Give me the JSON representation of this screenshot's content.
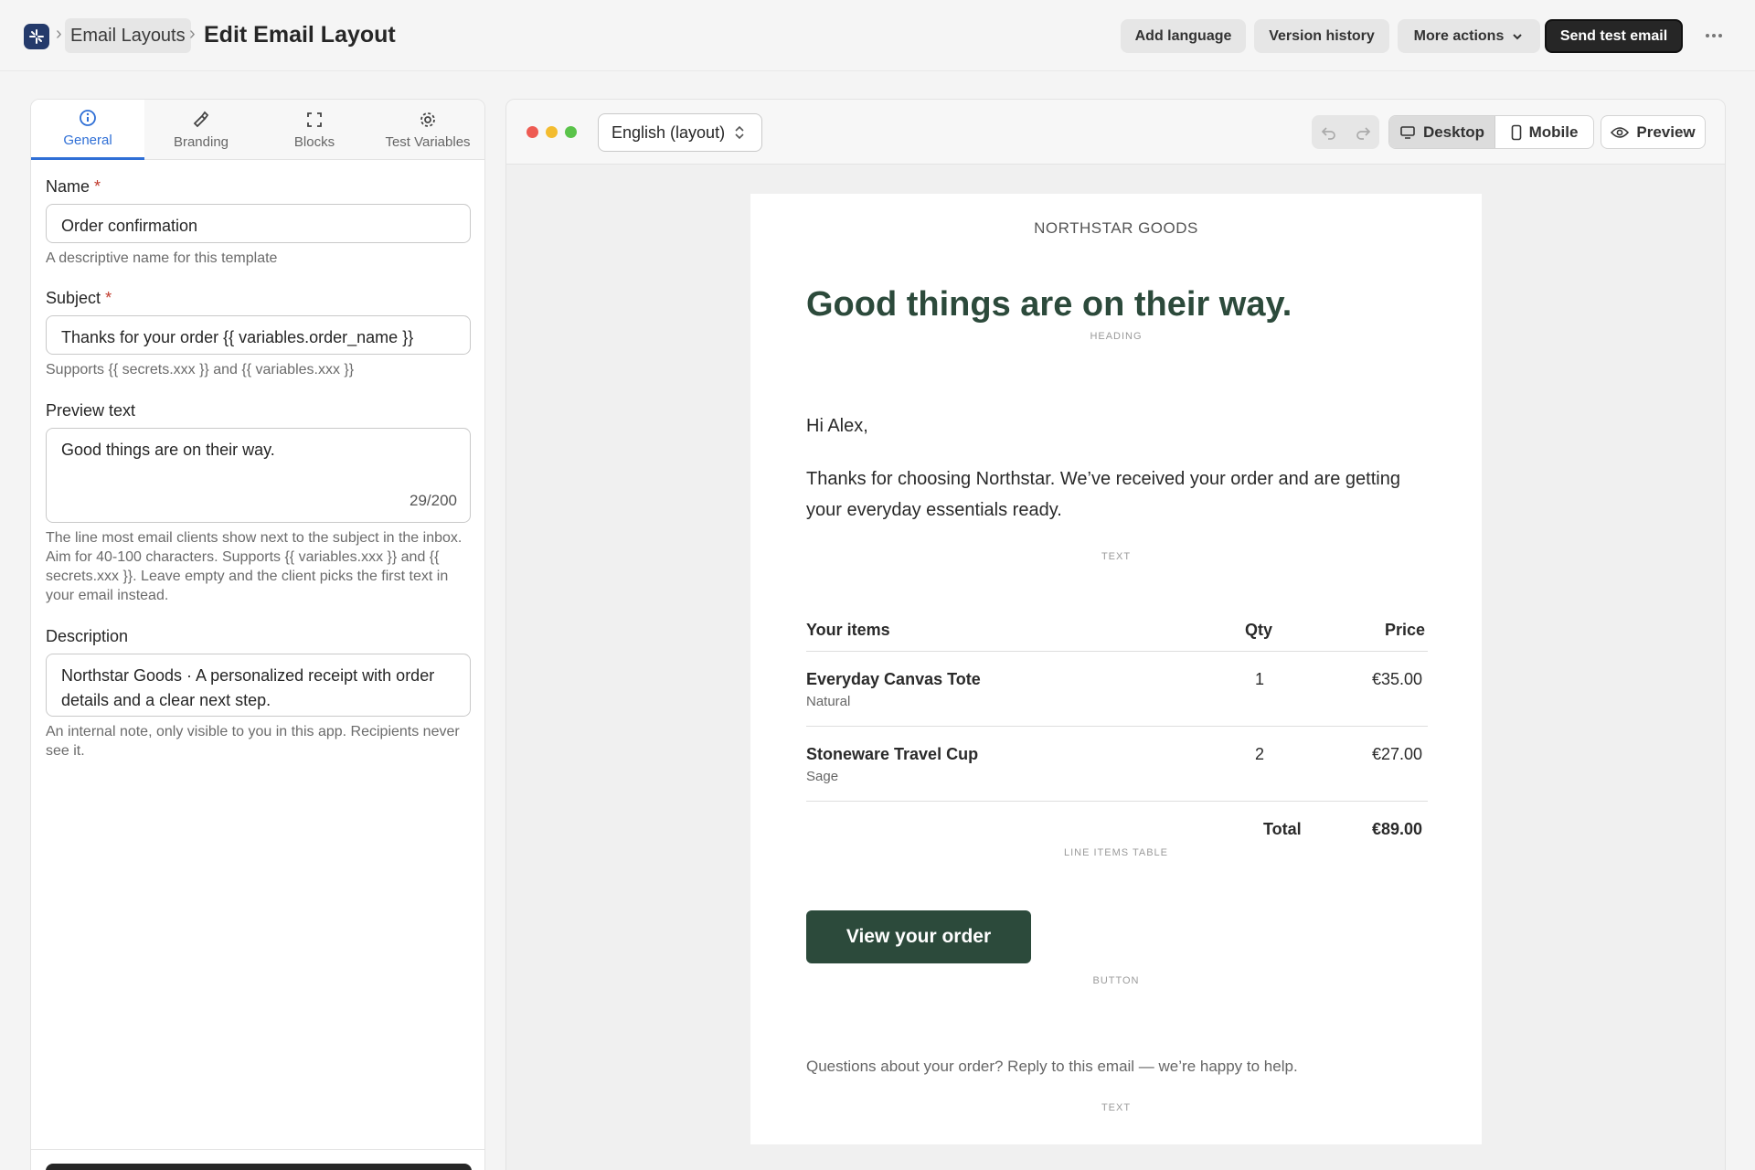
{
  "breadcrumb": {
    "parent": "Email Layouts",
    "current": "Edit Email Layout",
    "separator": "›"
  },
  "toolbar": {
    "add_language": "Add language",
    "version_history": "Version history",
    "more_actions": "More actions",
    "send_test": "Send test email"
  },
  "tabs": [
    {
      "label": "General",
      "icon": "info-icon"
    },
    {
      "label": "Branding",
      "icon": "brush-icon"
    },
    {
      "label": "Blocks",
      "icon": "frame-icon"
    },
    {
      "label": "Test Variables",
      "icon": "gear-icon"
    }
  ],
  "form": {
    "name_label": "Name",
    "name_value": "Order confirmation",
    "name_help": "A descriptive name for this template",
    "subject_label": "Subject",
    "subject_value": "Thanks for your order {{ variables.order_name }}",
    "subject_help": "Supports {{ secrets.xxx }} and {{ variables.xxx }}",
    "preview_label": "Preview text",
    "preview_value": "Good things are on their way.",
    "preview_counter": "29/200",
    "preview_help": "The line most email clients show next to the subject in the inbox. Aim for 40-100 characters. Supports {{ variables.xxx }} and {{ secrets.xxx }}. Leave empty and the client picks the first text in your email instead.",
    "description_label": "Description",
    "description_value": "Northstar Goods · A personalized receipt with order details and a clear next step.",
    "description_help": "An internal note, only visible to you in this app. Recipients never see it.",
    "required_mark": "*"
  },
  "preview_toolbar": {
    "language": "English (layout)",
    "desktop": "Desktop",
    "mobile": "Mobile",
    "preview": "Preview"
  },
  "email": {
    "brand": "NORTHSTAR GOODS",
    "heading": "Good things are on their way.",
    "heading_tag": "HEADING",
    "greeting": "Hi Alex,",
    "body": "Thanks for choosing Northstar. We’ve received your order and are getting your everyday essentials ready.",
    "text_tag": "TEXT",
    "table": {
      "col_items": "Your items",
      "col_qty": "Qty",
      "col_price": "Price",
      "rows": [
        {
          "name": "Everyday Canvas Tote",
          "variant": "Natural",
          "qty": "1",
          "price": "€35.00"
        },
        {
          "name": "Stoneware Travel Cup",
          "variant": "Sage",
          "qty": "2",
          "price": "€27.00"
        }
      ],
      "total_label": "Total",
      "total_value": "€89.00",
      "tag": "LINE ITEMS TABLE"
    },
    "cta": "View your order",
    "cta_tag": "BUTTON",
    "footer": "Questions about your order? Reply to this email — we’re happy to help.",
    "footer_tag": "TEXT"
  },
  "colors": {
    "accent": "#2f6fd6",
    "email_green": "#2c4a3b",
    "dark_button": "#262626"
  }
}
